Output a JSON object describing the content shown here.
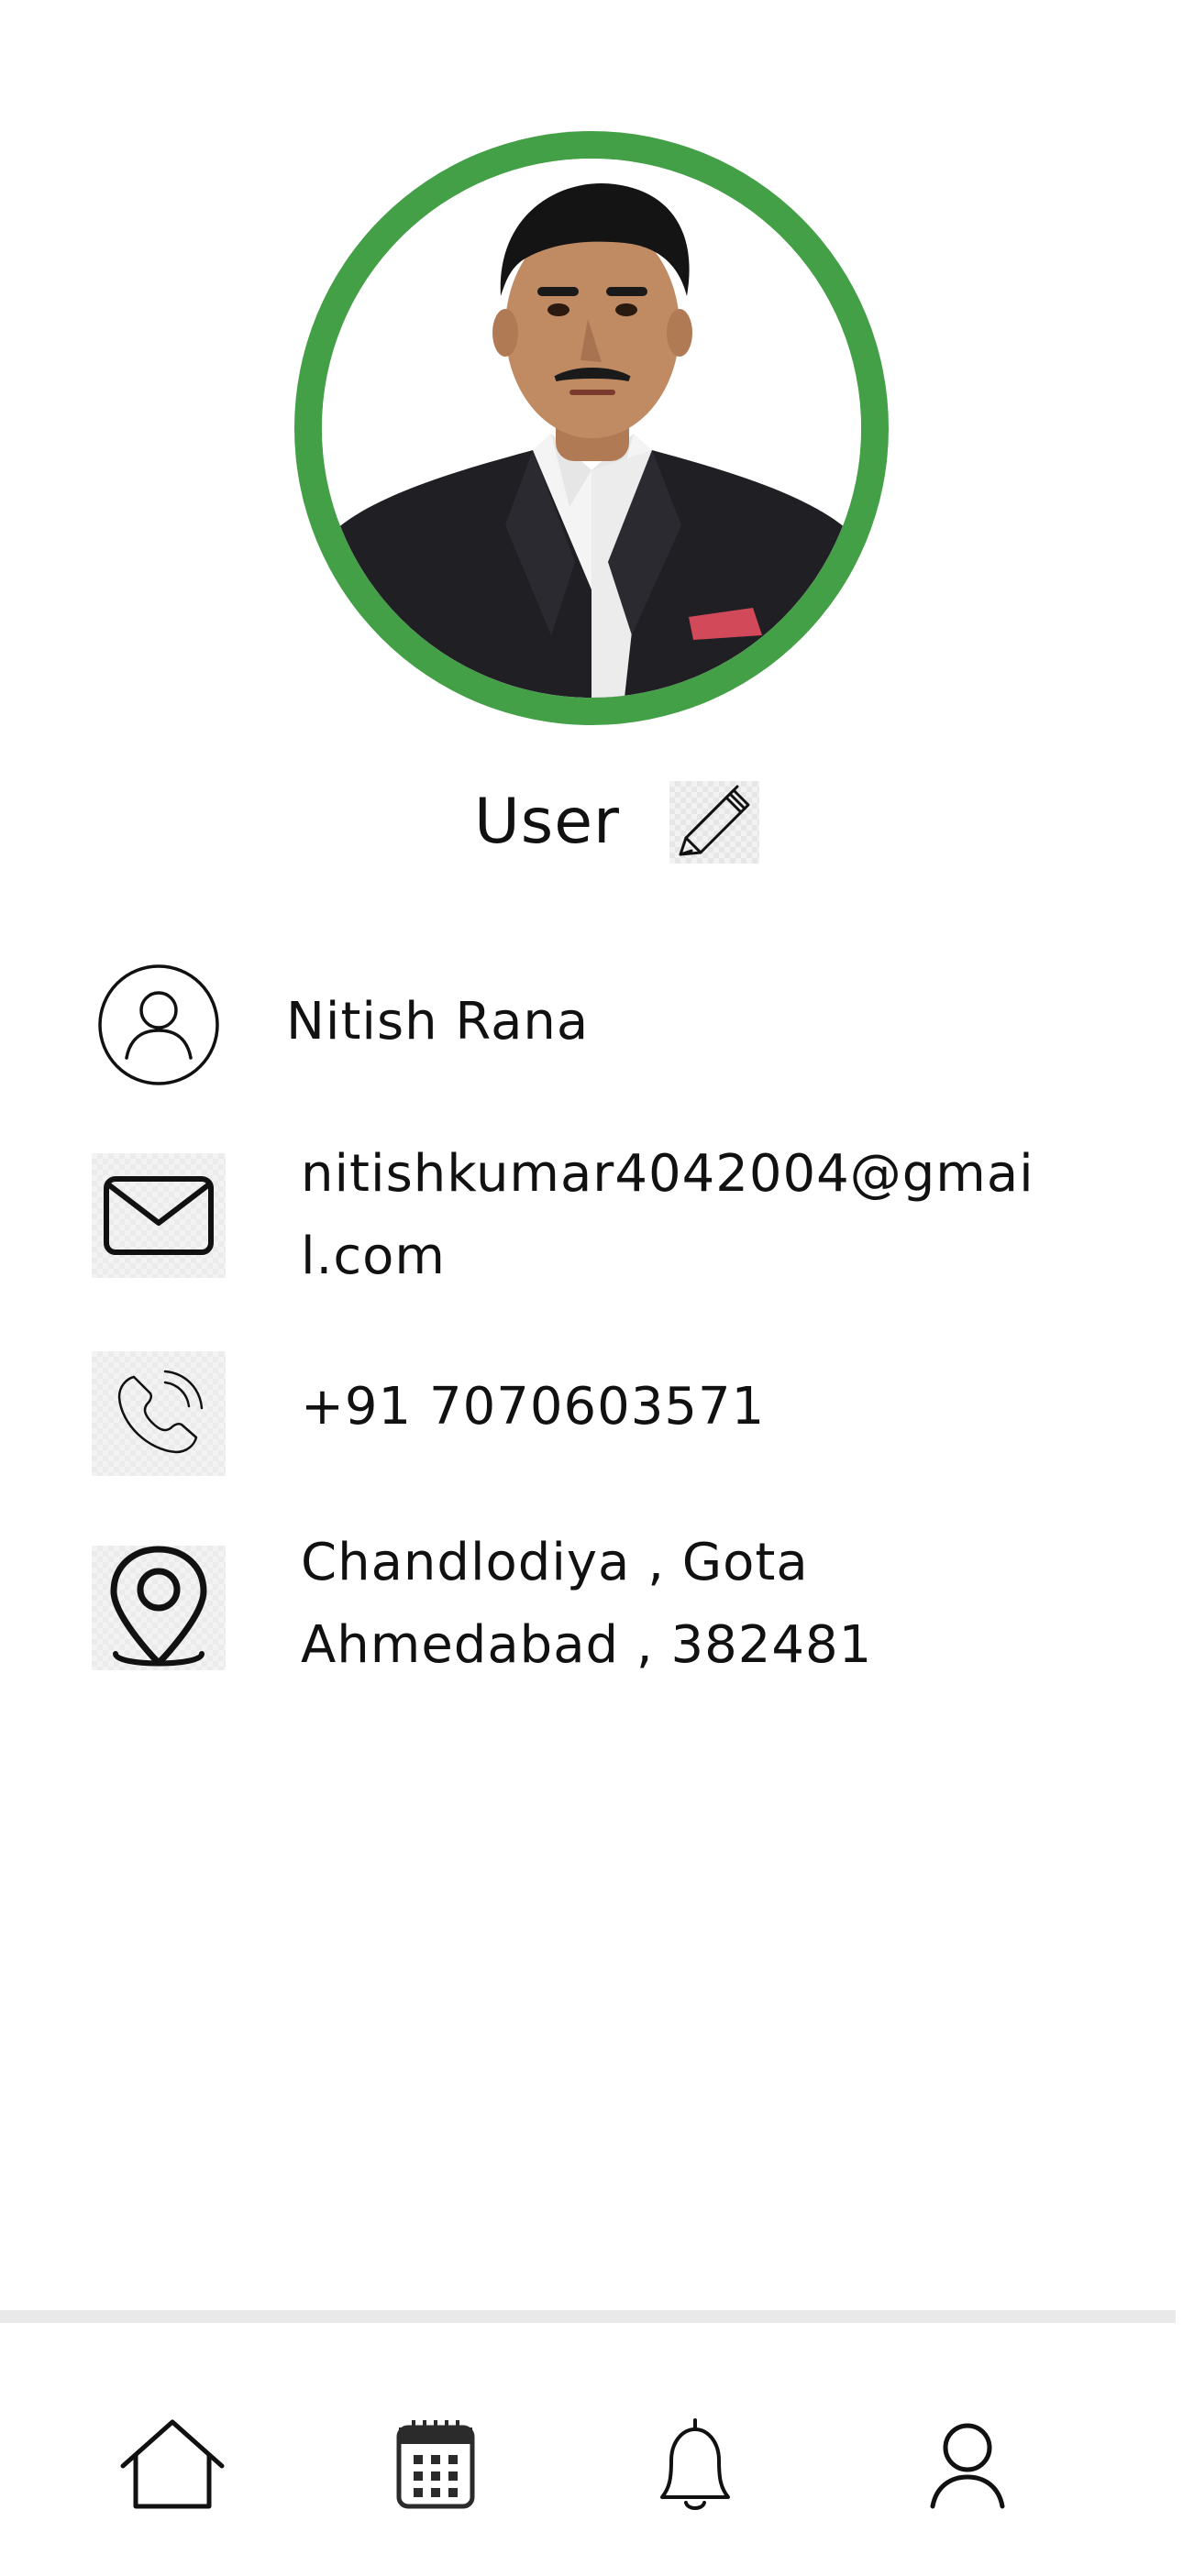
{
  "profile": {
    "role": "User",
    "name": "Nitish Rana",
    "email_line1": "nitishkumar4042004@gmai",
    "email_line2": "l.com",
    "phone": "+91 7070603571",
    "address_line1": "Chandlodiya , Gota",
    "address_line2": "Ahmedabad , 382481"
  },
  "colors": {
    "accent": "#43a047",
    "text": "#111111",
    "background": "#ffffff"
  },
  "icons": {
    "edit": "pencil-icon",
    "name": "user-circle-icon",
    "email": "mail-icon",
    "phone": "phone-icon",
    "address": "map-pin-icon"
  },
  "bottom_nav": [
    {
      "icon": "home-icon"
    },
    {
      "icon": "calendar-icon"
    },
    {
      "icon": "bell-icon"
    },
    {
      "icon": "profile-icon"
    }
  ]
}
